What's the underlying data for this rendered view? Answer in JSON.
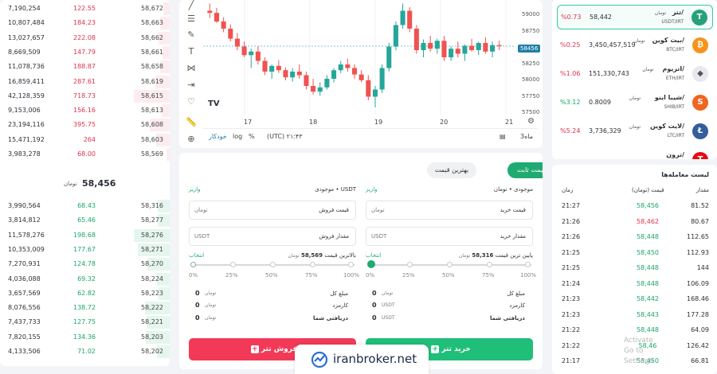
{
  "orderbook": {
    "unit": "تومان",
    "mid_price": "58,456",
    "asks": [
      {
        "total": "7,190,254",
        "amount": "122.55",
        "price": "58,672"
      },
      {
        "total": "10,807,484",
        "amount": "184.23",
        "price": "58,663"
      },
      {
        "total": "13,027,657",
        "amount": "222.08",
        "price": "58,662"
      },
      {
        "total": "8,669,509",
        "amount": "147.79",
        "price": "58,661"
      },
      {
        "total": "11,078,736",
        "amount": "188.87",
        "price": "58,658"
      },
      {
        "total": "16,859,411",
        "amount": "287.61",
        "price": "58,619"
      },
      {
        "total": "42,128,359",
        "amount": "718.73",
        "price": "58,615"
      },
      {
        "total": "9,153,006",
        "amount": "156.16",
        "price": "58,613"
      },
      {
        "total": "23,194,116",
        "amount": "395.75",
        "price": "58,608"
      },
      {
        "total": "15,471,192",
        "amount": "264",
        "price": "58,603"
      },
      {
        "total": "3,983,278",
        "amount": "68.00",
        "price": "58,569"
      }
    ],
    "bids": [
      {
        "total": "3,990,564",
        "amount": "68.43",
        "price": "58,316"
      },
      {
        "total": "3,814,812",
        "amount": "65.46",
        "price": "58,277"
      },
      {
        "total": "11,578,276",
        "amount": "198.68",
        "price": "58,276"
      },
      {
        "total": "10,353,009",
        "amount": "177.67",
        "price": "58,271"
      },
      {
        "total": "7,270,931",
        "amount": "124.78",
        "price": "58,270"
      },
      {
        "total": "4,036,088",
        "amount": "69.32",
        "price": "58,224"
      },
      {
        "total": "3,657,569",
        "amount": "62.82",
        "price": "58,223"
      },
      {
        "total": "8,076,556",
        "amount": "138.72",
        "price": "58,222"
      },
      {
        "total": "7,437,733",
        "amount": "127.75",
        "price": "58,221"
      },
      {
        "total": "7,820,155",
        "amount": "134.36",
        "price": "58,203"
      },
      {
        "total": "4,133,506",
        "amount": "71.02",
        "price": "58,202"
      }
    ]
  },
  "chart": {
    "y_ticks": [
      "59000",
      "58750",
      "58500",
      "58250",
      "58000",
      "57750",
      "57500"
    ],
    "x_ticks": [
      "17",
      "18",
      "19",
      "20",
      "21"
    ],
    "last_price": "58456",
    "bottom": {
      "range": "3ماه",
      "tz": "(UTC) ۲۱:۴۳",
      "pct": "%",
      "log": "log",
      "auto": "خودکار"
    },
    "chart_data": {
      "type": "candlestick",
      "ylim": [
        57500,
        59100
      ],
      "x_ticks": [
        "17",
        "18",
        "19",
        "20",
        "21"
      ],
      "last_price": 58456,
      "candles": [
        [
          58950,
          59050,
          58850,
          58920
        ],
        [
          58920,
          58990,
          58780,
          58800
        ],
        [
          58800,
          58860,
          58650,
          58700
        ],
        [
          58700,
          58760,
          58520,
          58560
        ],
        [
          58560,
          58640,
          58400,
          58450
        ],
        [
          58450,
          58520,
          58300,
          58330
        ],
        [
          58330,
          58420,
          58150,
          58380
        ],
        [
          58380,
          58450,
          58200,
          58250
        ],
        [
          58250,
          58300,
          58050,
          58100
        ],
        [
          58100,
          58200,
          58000,
          58180
        ],
        [
          58180,
          58260,
          58080,
          58120
        ],
        [
          58120,
          58160,
          57980,
          58020
        ],
        [
          58020,
          58150,
          57960,
          58100
        ],
        [
          58100,
          58200,
          58000,
          58050
        ],
        [
          58050,
          58100,
          57850,
          57900
        ],
        [
          57900,
          58000,
          57780,
          57820
        ],
        [
          57820,
          57950,
          57760,
          57880
        ],
        [
          57880,
          58050,
          57850,
          58000
        ],
        [
          58000,
          58150,
          57950,
          58120
        ],
        [
          58120,
          58250,
          58080,
          58200
        ],
        [
          58200,
          58280,
          58100,
          58150
        ],
        [
          58150,
          58200,
          58000,
          58060
        ],
        [
          58060,
          58120,
          57950,
          57980
        ],
        [
          57980,
          58050,
          57700,
          57750
        ],
        [
          57750,
          57900,
          57600,
          57850
        ],
        [
          57850,
          58200,
          57800,
          58150
        ],
        [
          58150,
          58500,
          58100,
          58450
        ],
        [
          58450,
          58800,
          58400,
          58750
        ],
        [
          58750,
          59050,
          58700,
          58950
        ],
        [
          58950,
          59000,
          58650,
          58700
        ],
        [
          58700,
          58750,
          58350,
          58400
        ],
        [
          58400,
          58550,
          58300,
          58500
        ],
        [
          58500,
          58600,
          58380,
          58420
        ],
        [
          58420,
          58560,
          58350,
          58530
        ],
        [
          58530,
          58600,
          58250,
          58300
        ],
        [
          58300,
          58450,
          58250,
          58420
        ],
        [
          58420,
          58520,
          58300,
          58350
        ],
        [
          58350,
          58480,
          58250,
          58460
        ],
        [
          58460,
          58560,
          58380,
          58400
        ],
        [
          58400,
          58520,
          58330,
          58500
        ],
        [
          58500,
          58580,
          58350,
          58380
        ],
        [
          58380,
          58520,
          58300,
          58470
        ],
        [
          58470,
          58530,
          58400,
          58456
        ]
      ]
    }
  },
  "trade": {
    "tab_fixed": "قیمت ثابت",
    "tab_best": "بهترین قیمت",
    "buy": {
      "balance": "موجودی • تومان",
      "deposit": "واریز",
      "price_label": "قیمت خرید",
      "price_unit": "تومان",
      "amount_label": "مقدار خرید",
      "amount_unit": "USDT",
      "extreme": "پایین ترین قیمت",
      "extreme_value": "58,316",
      "extreme_unit": "تومان",
      "choose": "انتخاب",
      "pcts": [
        "100%",
        "75%",
        "50%",
        "25%",
        "0%"
      ],
      "total_label": "مبلغ کل",
      "total_unit": "تومان",
      "total_value": "0",
      "fee_label": "کارمزد",
      "fee_unit": "USDT",
      "fee_value": "0",
      "receive_label": "دریافتی شما",
      "receive_unit": "USDT",
      "receive_value": "0",
      "button": "خرید تتر"
    },
    "sell": {
      "balance": "موجودی • USDT",
      "deposit": "واریز",
      "price_label": "قیمت فروش",
      "price_unit": "تومان",
      "amount_label": "مقدار فروش",
      "amount_unit": "USDT",
      "extreme": "بالاترین قیمت",
      "extreme_value": "58,569",
      "extreme_unit": "تومان",
      "choose": "انتخاب",
      "pcts": [
        "100%",
        "75%",
        "50%",
        "25%",
        "0%"
      ],
      "total_label": "مبلغ کل",
      "total_unit": "تومان",
      "total_value": "0",
      "fee_label": "کارمزد",
      "fee_unit": "تومان",
      "fee_value": "0",
      "receive_label": "دریافتی شما",
      "receive_unit": "تومان",
      "receive_value": "0",
      "button": "فروش تتر"
    }
  },
  "markets": [
    {
      "name": "تتر/",
      "unit": "تومان",
      "sym": "USDT/IRT",
      "price": "58,442",
      "change": "%0.73",
      "color": "#26a17b",
      "glyph": "T"
    },
    {
      "name": "بیت کوین/",
      "unit": "تومان",
      "sym": "BTC/IRT",
      "price": "3,450,457,519",
      "change": "%0.25",
      "color": "#f7931a",
      "glyph": "₿"
    },
    {
      "name": "اتریوم/",
      "unit": "تومان",
      "sym": "ETH/IRT",
      "price": "151,330,743",
      "change": "%1.06",
      "color": "#e8e8ee",
      "glyph": "◆"
    },
    {
      "name": "شیبا اینو/",
      "unit": "تومان",
      "sym": "SHIB/IRT",
      "price": "0.8009",
      "change": "%3.12",
      "color": "#f0661f",
      "glyph": "S"
    },
    {
      "name": "لایت کوین/",
      "unit": "تومان",
      "sym": "LTC/IRT",
      "price": "3,736,329",
      "change": "%5.24",
      "color": "#345d9d",
      "glyph": "Ł"
    },
    {
      "name": "ترون/",
      "unit": "",
      "sym": "",
      "price": "",
      "change": "",
      "color": "#e50914",
      "glyph": "T"
    }
  ],
  "trades": {
    "title": "لیست معامله‌ها",
    "h_time": "زمان",
    "h_price": "قیمت (تومان)",
    "h_amount": "مقدار",
    "rows": [
      {
        "time": "21:27",
        "price": "58,456",
        "amount": "81.52",
        "side": "buy"
      },
      {
        "time": "21:26",
        "price": "58,462",
        "amount": "80.67",
        "side": "sell"
      },
      {
        "time": "21:26",
        "price": "58,448",
        "amount": "112.65",
        "side": "buy"
      },
      {
        "time": "21:25",
        "price": "58,450",
        "amount": "112.93",
        "side": "buy"
      },
      {
        "time": "21:25",
        "price": "58,448",
        "amount": "144",
        "side": "buy"
      },
      {
        "time": "21:24",
        "price": "58,448",
        "amount": "106.09",
        "side": "buy"
      },
      {
        "time": "21:23",
        "price": "58,442",
        "amount": "168.46",
        "side": "buy"
      },
      {
        "time": "21:23",
        "price": "58,443",
        "amount": "177.28",
        "side": "buy"
      },
      {
        "time": "21:22",
        "price": "58,448",
        "amount": "64.09",
        "side": "buy"
      },
      {
        "time": "21:22",
        "price": "58,46",
        "amount": "126.42",
        "side": "buy"
      },
      {
        "time": "21:17",
        "price": "58,450",
        "amount": "66.81",
        "side": "buy"
      }
    ]
  },
  "logo": "iranbroker.net",
  "watermark": [
    "Activate",
    "Go to",
    "Settings"
  ]
}
